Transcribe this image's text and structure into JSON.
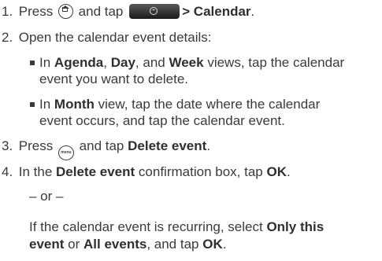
{
  "steps": [
    {
      "number": "1.",
      "parts": [
        "Press",
        "and tap",
        "> Calendar",
        "."
      ]
    },
    {
      "number": "2.",
      "text": "Open the calendar event details:"
    },
    {
      "number": "3.",
      "parts": [
        "Press",
        "and tap",
        "Delete event",
        "."
      ]
    },
    {
      "number": "4.",
      "parts": [
        "In the",
        "Delete event",
        "confirmation box, tap",
        "OK",
        "."
      ]
    }
  ],
  "bullets": [
    {
      "parts": [
        "In",
        "Agenda",
        ",",
        "Day",
        ", and",
        "Week",
        "views, tap the calendar"
      ],
      "cont": "event you want to delete."
    },
    {
      "parts": [
        "In",
        "Month",
        "view, tap the date where the calendar"
      ],
      "cont": "event occurs, and tap the calendar event."
    }
  ],
  "or_text": "– or –",
  "recurring": {
    "line1": "If the calendar event is recurring, select",
    "opt1": "Only this",
    "opt1b": "event",
    "or": "or",
    "opt2": "All events",
    "mid": ", and tap",
    "ok": "OK",
    "end": "."
  },
  "icons": {
    "home": "home-icon",
    "all_apps": "all-apps-tab-icon",
    "menu": "menu-icon",
    "menu_label": "menu"
  }
}
